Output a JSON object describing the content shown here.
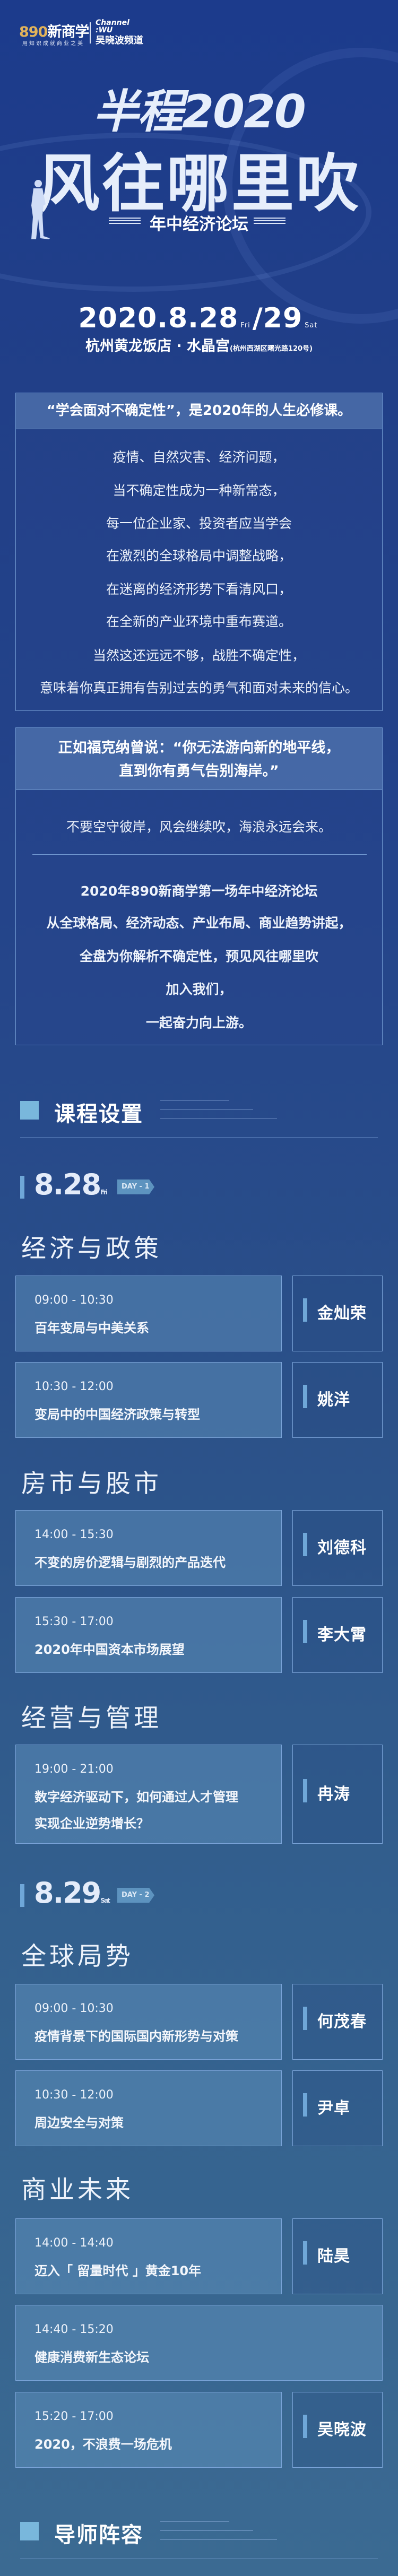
{
  "brand": {
    "logo_number": "890",
    "logo_name": "新商学",
    "tagline": "用知识成就商业之美",
    "partner_top": "Channel",
    "partner_sub": ":WU",
    "partner_name": "吴晓波频道"
  },
  "hero": {
    "title_line1": "半程2020",
    "title_line2": "风往哪里吹",
    "subtitle": "年中经济论坛",
    "date_main": "2020.8.28",
    "date_day1": "Fri",
    "date_sep": "/",
    "date_second": "29",
    "date_day2": "Sat",
    "venue": "杭州黄龙饭店 · 水晶宫",
    "venue_address": "(杭州西湖区曙光路120号)"
  },
  "intro": {
    "headline": "“学会面对不确定性”，是2020年的人生必修课。",
    "lines": [
      "疫情、自然灾害、经济问题，",
      "当不确定性成为一种新常态，",
      "每一位企业家、投资者应当学会",
      "在激烈的全球格局中调整战略，",
      "在迷离的经济形势下看清风口，",
      "在全新的产业环境中重布赛道。",
      "当然这还远远不够，战胜不确定性，",
      "意味着你真正拥有告别过去的勇气和面对未来的信心。"
    ]
  },
  "quote": {
    "headline_line1": "正如福克纳曾说：“你无法游向新的地平线，",
    "headline_line2": "直到你有勇气告别海岸。”",
    "line": "不要空守彼岸，风会继续吹，海浪永远会来。",
    "bold_lines": [
      "2020年890新商学第一场年中经济论坛",
      "从全球格局、经济动态、产业布局、商业趋势讲起，",
      "全盘为你解析不确定性，预见风往哪里吹",
      "加入我们，",
      "一起奋力向上游。"
    ]
  },
  "schedule_section": {
    "title": "课程设置"
  },
  "days": [
    {
      "date": "8.28",
      "weekday": "Fri",
      "badge": "DAY - 1"
    },
    {
      "date": "8.29",
      "weekday": "Sat",
      "badge": "DAY - 2"
    }
  ],
  "categories": [
    "经济与政策",
    "房市与股市",
    "经营与管理",
    "全球局势",
    "商业未来"
  ],
  "sessions": [
    {
      "time": "09:00 - 10:30",
      "title": "百年变局与中美关系",
      "speaker": "金灿荣"
    },
    {
      "time": "10:30 - 12:00",
      "title": "变局中的中国经济政策与转型",
      "speaker": "姚洋"
    },
    {
      "time": "14:00 - 15:30",
      "title": "不变的房价逻辑与剧烈的产品迭代",
      "speaker": "刘德科"
    },
    {
      "time": "15:30 - 17:00",
      "title": "2020年中国资本市场展望",
      "speaker": "李大霄"
    },
    {
      "time": "19:00 - 21:00",
      "title": "数字经济驱动下，如何通过人才管理实现企业逆势增长？",
      "title_lines": [
        "数字经济驱动下，如何通过人才管理",
        "实现企业逆势增长？"
      ],
      "speaker": "冉涛"
    },
    {
      "time": "09:00 - 10:30",
      "title": "疫情背景下的国际国内新形势与对策",
      "speaker": "何茂春"
    },
    {
      "time": "10:30 - 12:00",
      "title": "周边安全与对策",
      "speaker": "尹卓"
    },
    {
      "time": "14:00 - 14:40",
      "title": "迈入「 留量时代 」黄金10年",
      "speaker": "陆昊"
    },
    {
      "time": "14:40 - 15:20",
      "title": "健康消费新生态论坛",
      "speaker": null
    },
    {
      "time": "15:20 - 17:00",
      "title": "2020，不浪费一场危机",
      "speaker": "吴晓波"
    }
  ],
  "mentor_section": {
    "title": "导师阵容"
  },
  "colors": {
    "accent": "#79b7dc",
    "gold": "#e2b35a",
    "background_top": "#1c3b8c",
    "background_bottom": "#3b6a92"
  }
}
